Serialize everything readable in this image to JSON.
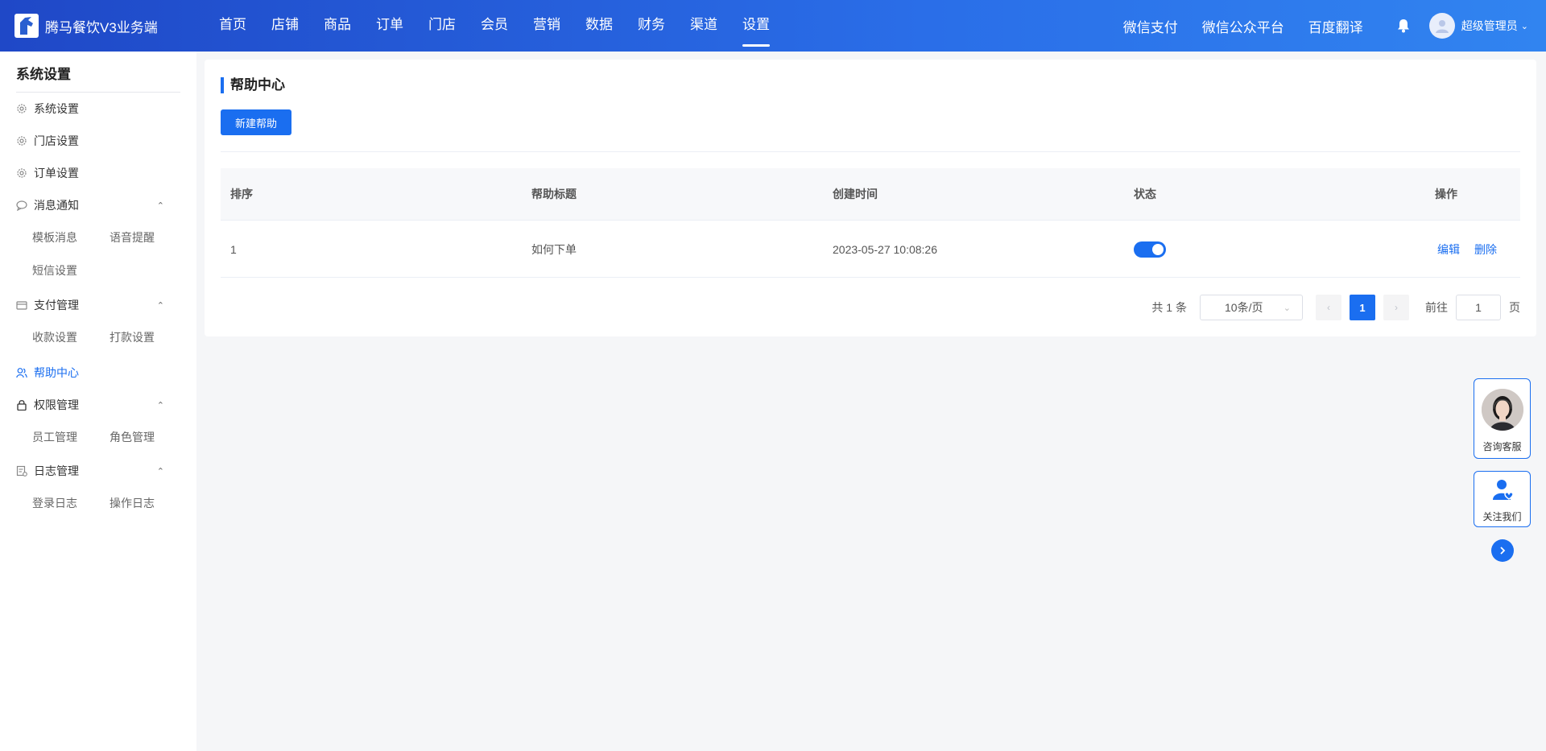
{
  "app": {
    "name": "腾马餐饮V3业务端"
  },
  "nav": {
    "items": [
      "首页",
      "店铺",
      "商品",
      "订单",
      "门店",
      "会员",
      "营销",
      "数据",
      "财务",
      "渠道",
      "设置"
    ],
    "active": "设置"
  },
  "header": {
    "links": [
      "微信支付",
      "微信公众平台",
      "百度翻译"
    ],
    "user": "超级管理员"
  },
  "sidebar": {
    "title": "系统设置",
    "items": {
      "system": "系统设置",
      "store": "门店设置",
      "order": "订单设置",
      "message": "消息通知",
      "message_sub": [
        "模板消息",
        "语音提醒",
        "短信设置"
      ],
      "payment": "支付管理",
      "payment_sub": [
        "收款设置",
        "打款设置"
      ],
      "help": "帮助中心",
      "permission": "权限管理",
      "permission_sub": [
        "员工管理",
        "角色管理"
      ],
      "log": "日志管理",
      "log_sub": [
        "登录日志",
        "操作日志"
      ]
    },
    "active": "帮助中心"
  },
  "page": {
    "title": "帮助中心",
    "new_button": "新建帮助",
    "table": {
      "columns": [
        "排序",
        "帮助标题",
        "创建时间",
        "状态",
        "操作"
      ],
      "rows": [
        {
          "sort": "1",
          "title": "如何下单",
          "created": "2023-05-27 10:08:26",
          "enabled": true,
          "actions": [
            "编辑",
            "删除"
          ]
        }
      ]
    },
    "pagination": {
      "total": "共 1 条",
      "page_size": "10条/页",
      "current": "1",
      "goto_label": "前往",
      "goto_value": "1",
      "page_unit": "页"
    }
  },
  "float": {
    "consult": "咨询客服",
    "follow": "关注我们"
  },
  "colors": {
    "primary": "#1a6ef0",
    "header_start": "#1f48c7",
    "header_end": "#3184f0"
  }
}
